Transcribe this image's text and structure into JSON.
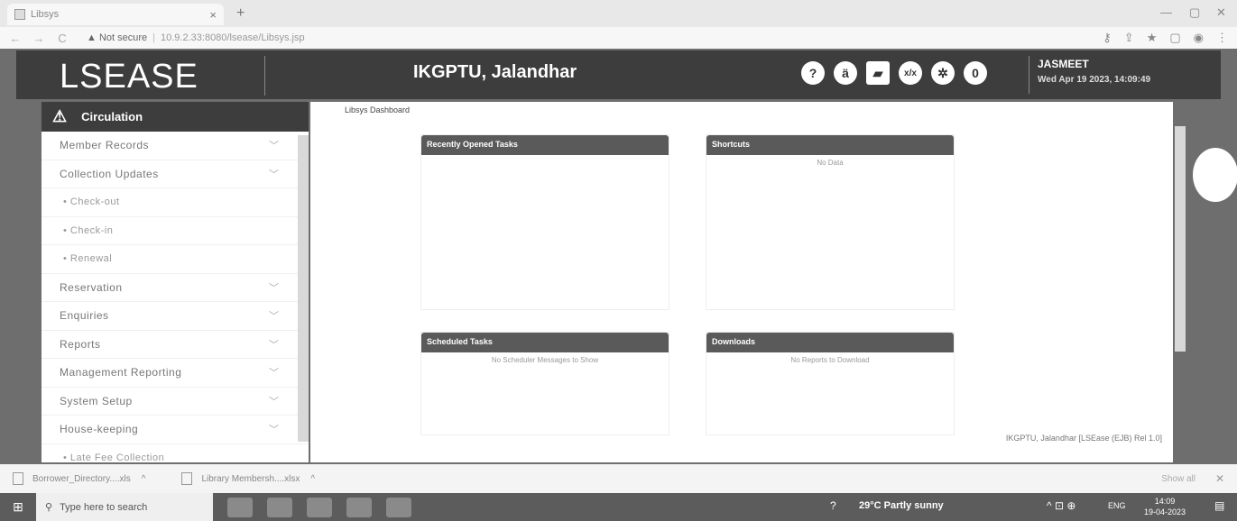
{
  "browser": {
    "tab_title": "Libsys",
    "tab_close": "×",
    "new_tab": "+",
    "security_label": "Not secure",
    "url": "10.9.2.33:8080/lsease/Libsys.jsp",
    "win_minimize": "—",
    "win_restore": "▢",
    "win_close": "✕"
  },
  "header": {
    "logo": "LSEASE",
    "title": "IKGPTU, Jalandhar",
    "notification_count": "0",
    "user_name": "JASMEET",
    "datetime": "Wed Apr 19 2023, 14:09:49",
    "icons": [
      "help-icon",
      "language-icon",
      "image-icon",
      "calculator-icon",
      "settings-icon"
    ]
  },
  "sidebar": {
    "section": "Circulation",
    "items": [
      {
        "label": "Member Records",
        "sub": false,
        "chevron": true
      },
      {
        "label": "Collection Updates",
        "sub": false,
        "chevron": true
      },
      {
        "label": "• Check-out",
        "sub": true,
        "chevron": false
      },
      {
        "label": "• Check-in",
        "sub": true,
        "chevron": false
      },
      {
        "label": "• Renewal",
        "sub": true,
        "chevron": false
      },
      {
        "label": "Reservation",
        "sub": false,
        "chevron": true
      },
      {
        "label": "Enquiries",
        "sub": false,
        "chevron": true
      },
      {
        "label": "Reports",
        "sub": false,
        "chevron": true
      },
      {
        "label": "Management Reporting",
        "sub": false,
        "chevron": true
      },
      {
        "label": "System Setup",
        "sub": false,
        "chevron": true
      },
      {
        "label": "House-keeping",
        "sub": false,
        "chevron": true
      },
      {
        "label": "• Late Fee Collection",
        "sub": true,
        "chevron": false
      }
    ]
  },
  "main": {
    "breadcrumb": "Libsys Dashboard",
    "panels": {
      "recent": {
        "title": "Recently Opened Tasks",
        "message": ""
      },
      "shortcuts": {
        "title": "Shortcuts",
        "message": "No Data"
      },
      "scheduled": {
        "title": "Scheduled Tasks",
        "message": "No Scheduler Messages to Show"
      },
      "downloads": {
        "title": "Downloads",
        "message": "No Reports to Download"
      }
    },
    "footer": "IKGPTU, Jalandhar [LSEase (EJB) Rel 1.0]"
  },
  "download_bar": {
    "files": [
      "Borrower_Directory....xls",
      "Library Membersh....xlsx"
    ],
    "show_all": "Show all",
    "close": "✕"
  },
  "taskbar": {
    "search_placeholder": "Type here to search",
    "weather": "29°C  Partly sunny",
    "language": "ENG",
    "time": "14:09",
    "date": "19-04-2023"
  }
}
